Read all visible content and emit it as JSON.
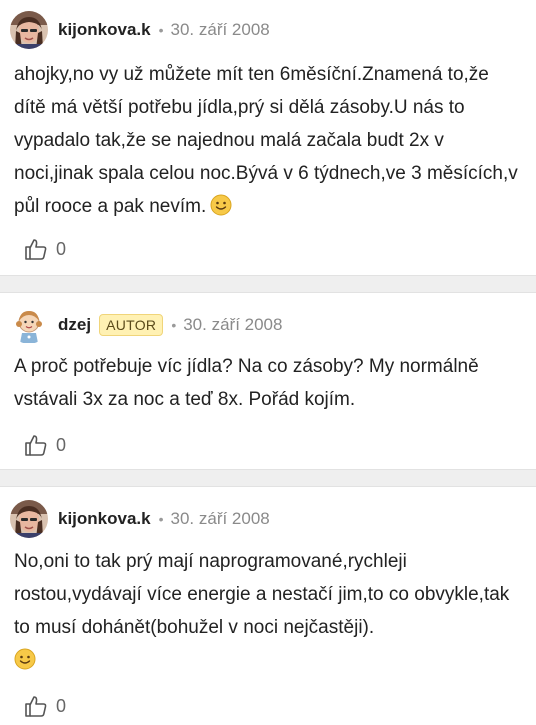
{
  "comments": [
    {
      "username": "kijonkova.k",
      "date": "30. září 2008",
      "text": "ahojky,no vy už můžete mít ten 6měsíční.Znamená to,že dítě má větší potřebu jídla,prý si dělá zásoby.U nás to vypadalo tak,že se najednou malá začala budt 2x v noci,jinak spala celou noc.Bývá v 6 týdnech,ve 3 měsících,v půl rooce a pak nevím.",
      "emoji": "smiley-icon",
      "likes": "0"
    },
    {
      "username": "dzej",
      "badge": "AUTOR",
      "date": "30. září 2008",
      "text": "A proč potřebuje víc jídla? Na co zásoby? My normálně vstávali 3x za noc a teď 8x. Pořád kojím.",
      "likes": "0"
    },
    {
      "username": "kijonkova.k",
      "date": "30. září 2008",
      "text": "No,oni to tak prý mají naprogramované,rychleji rostou,vydávají více energie a nestačí jim,to co obvykle,tak to musí dohánět(bohužel v noci nejčastěji).",
      "emoji": "smiley-icon",
      "likes": "0"
    }
  ],
  "separator_dot": "•",
  "colors": {
    "separator": "#efefef",
    "badge_bg": "#fff1b3",
    "text": "#222222",
    "meta": "#8a8a8a"
  }
}
